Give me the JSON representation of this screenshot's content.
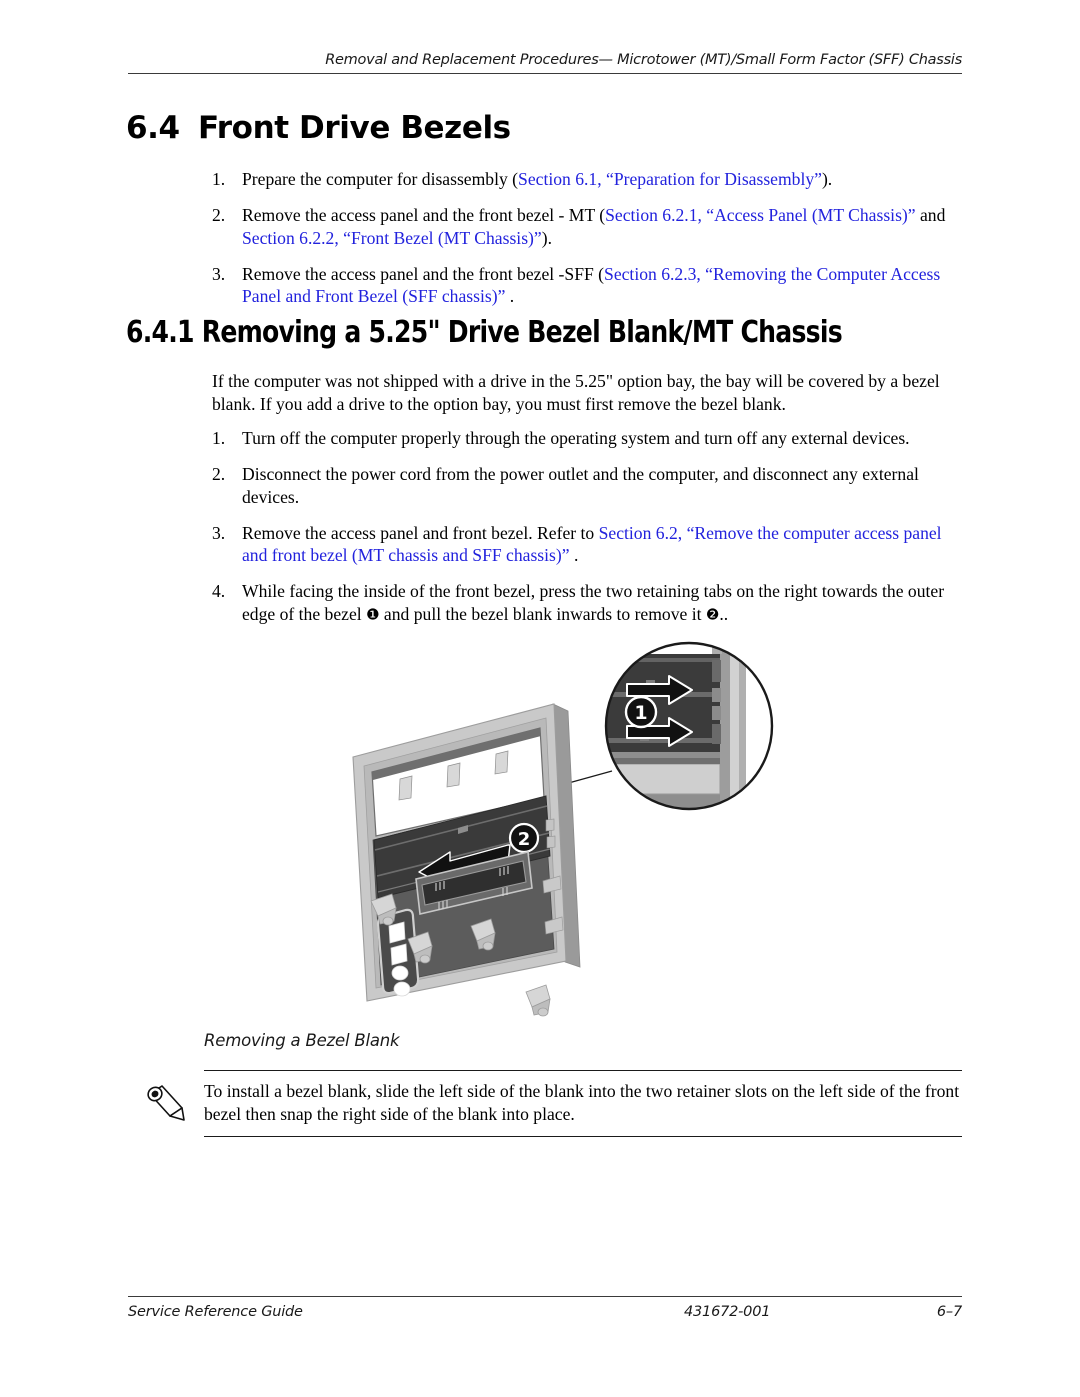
{
  "header": {
    "running_title": "Removal and Replacement Procedures— Microtower (MT)/Small Form Factor (SFF) Chassis"
  },
  "section_64": {
    "number": "6.4",
    "title": "Front Drive Bezels",
    "steps": [
      {
        "marker": "1.",
        "parts": [
          {
            "text": "Prepare the computer for disassembly (",
            "link": false
          },
          {
            "text": "Section 6.1, “Preparation for Disassembly”",
            "link": true
          },
          {
            "text": ").",
            "link": false
          }
        ]
      },
      {
        "marker": "2.",
        "parts": [
          {
            "text": "Remove the access panel and the front bezel - MT  (",
            "link": false
          },
          {
            "text": "Section 6.2.1, “Access Panel (MT Chassis)”",
            "link": true
          },
          {
            "text": " and ",
            "link": false
          },
          {
            "text": "Section 6.2.2, “Front Bezel (MT Chassis)”",
            "link": true
          },
          {
            "text": ").",
            "link": false
          }
        ]
      },
      {
        "marker": "3.",
        "parts": [
          {
            "text": "Remove the access panel and the front bezel -SFF (",
            "link": false
          },
          {
            "text": "Section 6.2.3, “Removing the Computer Access Panel and Front Bezel (SFF chassis)”",
            "link": true
          },
          {
            "text": " .",
            "link": false
          }
        ]
      }
    ]
  },
  "section_641": {
    "title": "6.4.1 Removing a 5.25\" Drive Bezel Blank/MT Chassis",
    "intro": "If the computer was not shipped with a drive in the 5.25\" option bay, the bay will be covered by a bezel blank. If you add a drive to the option bay, you must first remove the bezel blank.",
    "steps": [
      {
        "marker": "1.",
        "parts": [
          {
            "text": "Turn off the computer properly through the operating system and turn off any external devices.",
            "link": false
          }
        ]
      },
      {
        "marker": "2.",
        "parts": [
          {
            "text": "Disconnect the power cord from the power outlet and the computer, and disconnect any external devices.",
            "link": false
          }
        ]
      },
      {
        "marker": "3.",
        "parts": [
          {
            "text": "Remove the access panel and front bezel. Refer to ",
            "link": false
          },
          {
            "text": "Section 6.2, “Remove the computer access panel and front bezel  (MT chassis and SFF chassis)”",
            "link": true
          },
          {
            "text": " .",
            "link": false
          }
        ]
      },
      {
        "marker": "4.",
        "parts": [
          {
            "text": "While facing the inside of the front bezel, press the two retaining tabs on the right towards the outer edge of the bezel ",
            "link": false
          },
          {
            "text": "❶",
            "link": false,
            "circle": true
          },
          {
            "text": " and pull the bezel blank inwards to remove it ",
            "link": false
          },
          {
            "text": "❷",
            "link": false,
            "circle": true
          },
          {
            "text": "..",
            "link": false
          }
        ]
      }
    ]
  },
  "figure": {
    "caption": "Removing a Bezel Blank",
    "callout_1": "1",
    "callout_2": "2",
    "colors": {
      "bezel_frame_light": "#d6d6d6",
      "bezel_frame_mid": "#b4b4b4",
      "bezel_body_dark": "#5a5a5a",
      "blank_dark": "#3c3c3c",
      "tab_light": "#d0d0d0",
      "arrow_black": "#111111",
      "outline": "#1a1a1a"
    }
  },
  "note": {
    "icon": "pencil-icon",
    "text": "To install a bezel blank, slide the left side of the blank into the two retainer slots on the left side of the front bezel then snap the right side of the blank into place."
  },
  "footer": {
    "left": "Service Reference Guide",
    "center": "431672-001",
    "right": "6–7"
  }
}
